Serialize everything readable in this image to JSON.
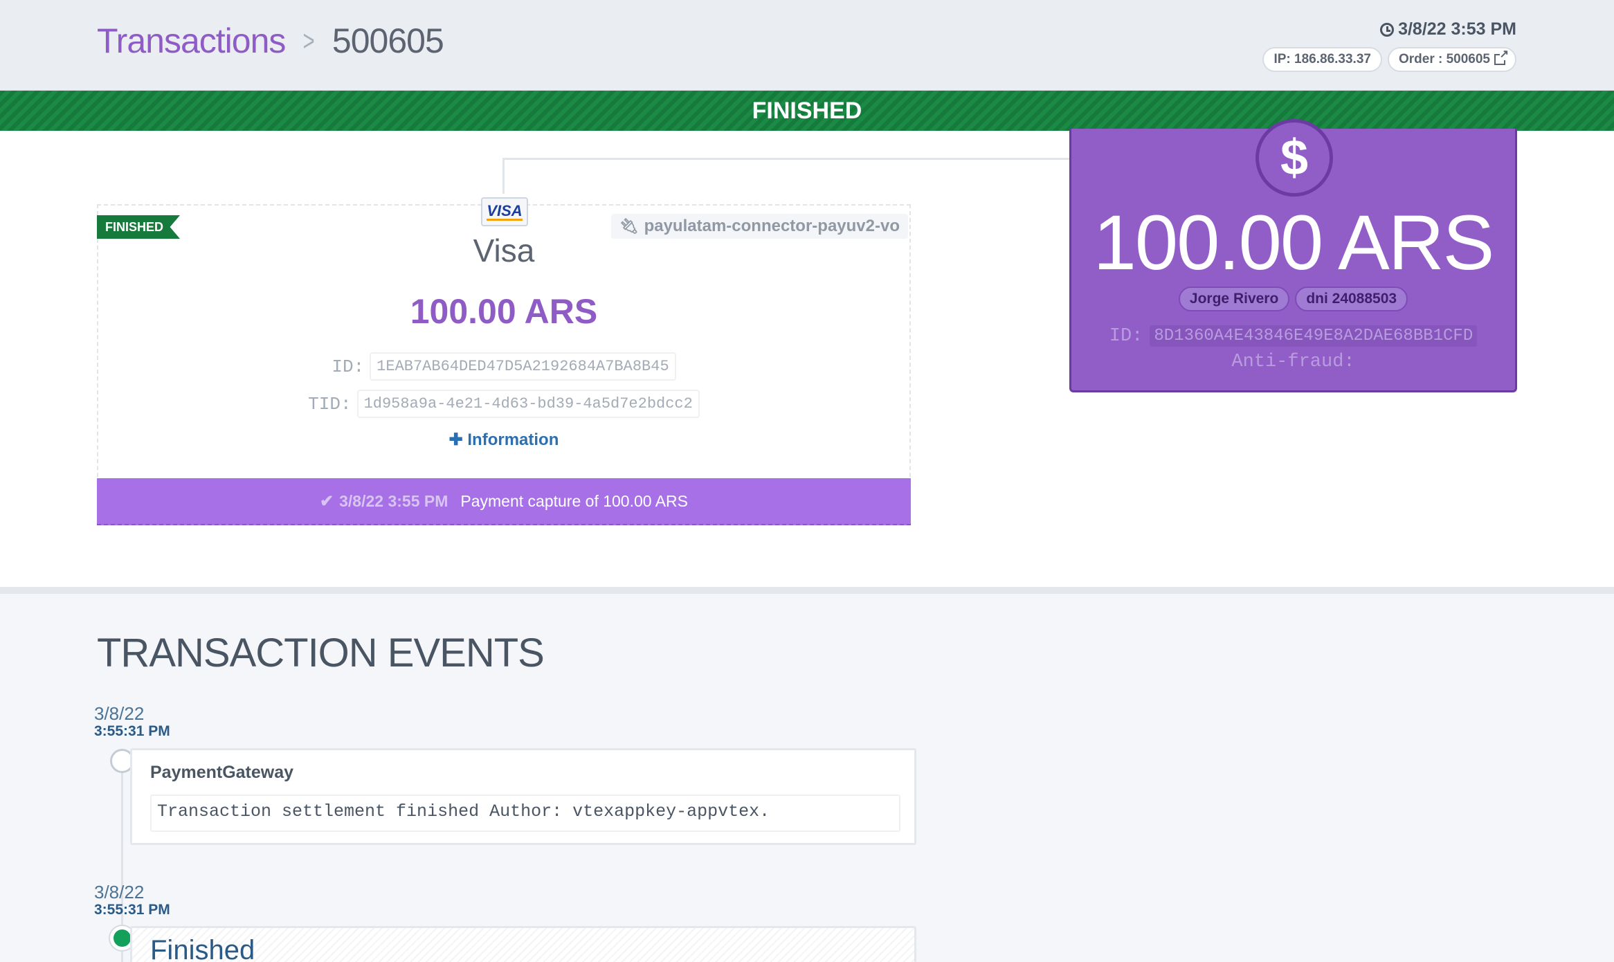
{
  "breadcrumb": {
    "parent": "Transactions",
    "separator": ">",
    "current": "500605"
  },
  "header": {
    "datetime": "3/8/22 3:53 PM",
    "ip": "IP: 186.86.33.37",
    "order": "Order : 500605"
  },
  "status_banner": "FINISHED",
  "payment": {
    "ribbon": "FINISHED",
    "brand_logo": "VISA",
    "connector": "payulatam-connector-payuv2-vo",
    "method": "Visa",
    "amount": "100.00 ARS",
    "id_label": "ID:",
    "id_value": "1EAB7AB64DED47D5A2192684A7BA8B45",
    "tid_label": "TID:",
    "tid_value": "1d958a9a-4e21-4d63-bd39-4a5d7e2bdcc2",
    "info_link": "Information",
    "footer_date": "3/8/22 3:55 PM",
    "footer_text": "Payment capture of  100.00 ARS"
  },
  "total": {
    "icon": "$",
    "amount": "100.00 ARS",
    "buyer_name": "Jorge Rivero",
    "buyer_doc": "dni 24088503",
    "id_label": "ID:",
    "id_value": "8D1360A4E43846E49E8A2DAE68BB1CFD",
    "anti_fraud_label": "Anti-fraud:"
  },
  "events": {
    "title": "TRANSACTION EVENTS",
    "items": [
      {
        "date": "3/8/22",
        "time": "3:55:31 PM",
        "source": "PaymentGateway",
        "message": "Transaction settlement finished Author: vtexappkey-appvtex."
      },
      {
        "date": "3/8/22",
        "time": "3:55:31 PM",
        "status": "Finished"
      }
    ]
  },
  "colors": {
    "accent_purple": "#8e5cc4",
    "finished_green": "#157a3c",
    "link_blue": "#2b6fb0"
  },
  "icons": [
    "clock-icon",
    "external-link-icon",
    "plug-icon",
    "check-icon",
    "plus-icon",
    "dollar-icon"
  ]
}
